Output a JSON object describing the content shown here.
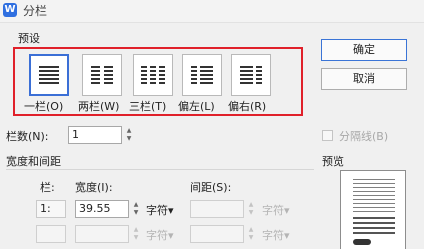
{
  "window": {
    "title": "分栏",
    "app_icon": "W"
  },
  "presets": {
    "group_label": "预设",
    "items": [
      {
        "label": "一栏(O)",
        "icon": "one-column-icon",
        "selected": true
      },
      {
        "label": "两栏(W)",
        "icon": "two-columns-icon",
        "selected": false
      },
      {
        "label": "三栏(T)",
        "icon": "three-columns-icon",
        "selected": false
      },
      {
        "label": "偏左(L)",
        "icon": "left-column-icon",
        "selected": false
      },
      {
        "label": "偏右(R)",
        "icon": "right-column-icon",
        "selected": false
      }
    ],
    "highlight_color": "#e0202a"
  },
  "buttons": {
    "ok": "确定",
    "cancel": "取消"
  },
  "columns": {
    "label": "栏数(N):",
    "value": "1"
  },
  "separator": {
    "label": "分隔线(B)",
    "checked": false
  },
  "width_spacing": {
    "group_label": "宽度和间距",
    "col_header": "栏:",
    "width_header": "宽度(I):",
    "spacing_header": "间距(S):",
    "rows": [
      {
        "col": "1:",
        "width": "39.55",
        "width_unit": "字符▾",
        "spacing": "",
        "spacing_unit": "字符▾"
      },
      {
        "col": "",
        "width": "",
        "width_unit": "字符▾",
        "spacing": "",
        "spacing_unit": "字符▾"
      }
    ]
  },
  "preview": {
    "label": "预览"
  }
}
